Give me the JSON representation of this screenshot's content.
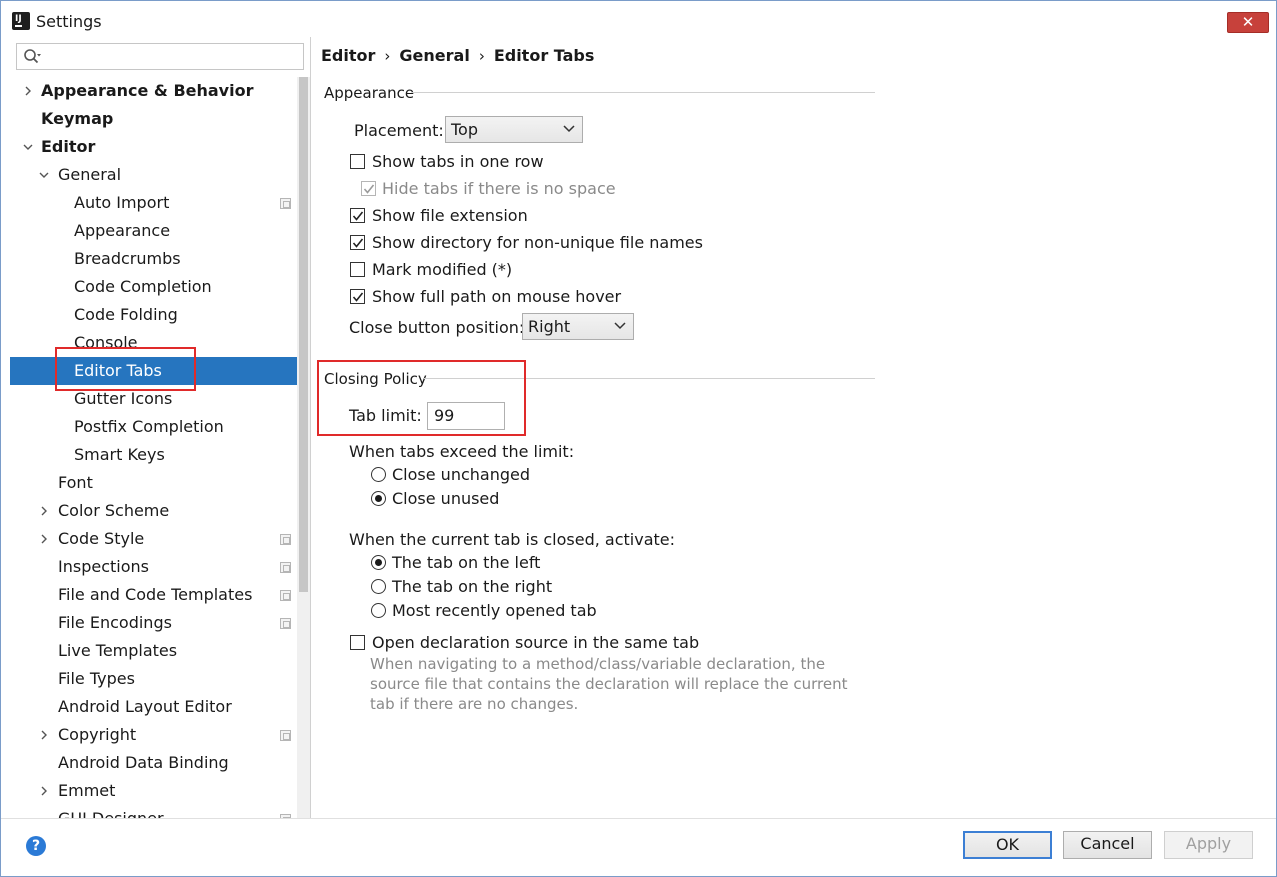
{
  "window": {
    "title": "Settings",
    "close_glyph": "✕"
  },
  "search": {
    "icon": "search-icon"
  },
  "tree": {
    "items": [
      {
        "label": "Appearance & Behavior",
        "level": 0,
        "expander": "collapsed",
        "bold": true
      },
      {
        "label": "Keymap",
        "level": 0,
        "expander": "none",
        "bold": true
      },
      {
        "label": "Editor",
        "level": 0,
        "expander": "expanded",
        "bold": true
      },
      {
        "label": "General",
        "level": 1,
        "expander": "expanded"
      },
      {
        "label": "Auto Import",
        "level": 2,
        "copy": true
      },
      {
        "label": "Appearance",
        "level": 2
      },
      {
        "label": "Breadcrumbs",
        "level": 2
      },
      {
        "label": "Code Completion",
        "level": 2
      },
      {
        "label": "Code Folding",
        "level": 2
      },
      {
        "label": "Console",
        "level": 2
      },
      {
        "label": "Editor Tabs",
        "level": 2,
        "selected": true
      },
      {
        "label": "Gutter Icons",
        "level": 2
      },
      {
        "label": "Postfix Completion",
        "level": 2
      },
      {
        "label": "Smart Keys",
        "level": 2
      },
      {
        "label": "Font",
        "level": 1
      },
      {
        "label": "Color Scheme",
        "level": 1,
        "expander": "collapsed"
      },
      {
        "label": "Code Style",
        "level": 1,
        "expander": "collapsed",
        "copy": true
      },
      {
        "label": "Inspections",
        "level": 1,
        "copy": true
      },
      {
        "label": "File and Code Templates",
        "level": 1,
        "copy": true
      },
      {
        "label": "File Encodings",
        "level": 1,
        "copy": true
      },
      {
        "label": "Live Templates",
        "level": 1
      },
      {
        "label": "File Types",
        "level": 1
      },
      {
        "label": "Android Layout Editor",
        "level": 1
      },
      {
        "label": "Copyright",
        "level": 1,
        "expander": "collapsed",
        "copy": true
      },
      {
        "label": "Android Data Binding",
        "level": 1
      },
      {
        "label": "Emmet",
        "level": 1,
        "expander": "collapsed"
      },
      {
        "label": "GUI Designer",
        "level": 1,
        "copy": true
      }
    ]
  },
  "breadcrumb": {
    "parts": [
      "Editor",
      "General",
      "Editor Tabs"
    ],
    "separator": "›"
  },
  "appearance": {
    "section_title": "Appearance",
    "placement_label": "Placement:",
    "placement_value": "Top",
    "show_tabs_one_row": {
      "label": "Show tabs in one row",
      "checked": false
    },
    "hide_tabs_no_space": {
      "label": "Hide tabs if there is no space",
      "checked": true,
      "disabled": true
    },
    "show_file_extension": {
      "label": "Show file extension",
      "checked": true
    },
    "show_directory": {
      "label": "Show directory for non-unique file names",
      "checked": true
    },
    "mark_modified": {
      "label": "Mark modified (*)",
      "checked": false
    },
    "show_full_path": {
      "label": "Show full path on mouse hover",
      "checked": true
    },
    "close_button_label": "Close button position:",
    "close_button_value": "Right"
  },
  "closing_policy": {
    "section_title": "Closing Policy",
    "tab_limit_label": "Tab limit:",
    "tab_limit_value": "99",
    "exceed_label": "When tabs exceed the limit:",
    "close_unchanged": {
      "label": "Close unchanged",
      "selected": false
    },
    "close_unused": {
      "label": "Close unused",
      "selected": true
    },
    "activate_label": "When the current tab is closed, activate:",
    "tab_left": {
      "label": "The tab on the left",
      "selected": true
    },
    "tab_right": {
      "label": "The tab on the right",
      "selected": false
    },
    "most_recent": {
      "label": "Most recently opened tab",
      "selected": false
    },
    "open_declaration": {
      "label": "Open declaration source in the same tab",
      "checked": false
    },
    "open_declaration_hint": "When navigating to a method/class/variable declaration, the source file that contains the declaration will replace the current tab if there are no changes."
  },
  "buttons": {
    "ok": "OK",
    "cancel": "Cancel",
    "apply": "Apply",
    "help": "?"
  },
  "colors": {
    "selection": "#2675bf",
    "highlight_box": "#e02a2a",
    "default_button_border": "#3c7fd4"
  }
}
